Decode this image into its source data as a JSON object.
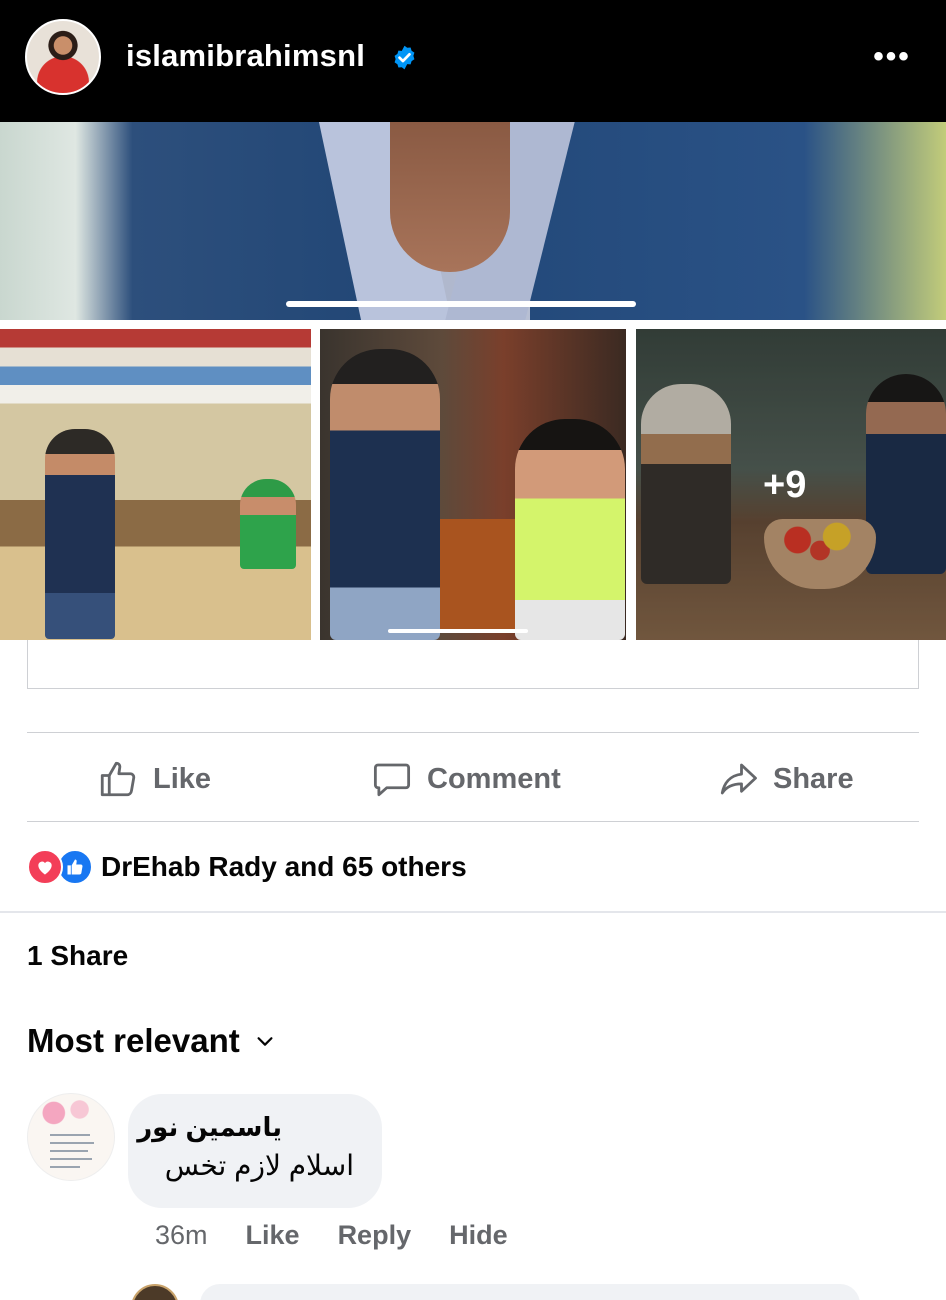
{
  "story_header": {
    "username": "islamibrahimsnl",
    "verified": true,
    "more_icon": "more-horizontal-icon"
  },
  "media": {
    "extra_photos_label": "+9"
  },
  "actions": {
    "like_label": "Like",
    "comment_label": "Comment",
    "share_label": "Share"
  },
  "reactions": {
    "summary": "DrEhab Rady and 65 others",
    "icons": [
      "love-reaction-icon",
      "like-reaction-icon"
    ]
  },
  "shares": {
    "label": "1 Share"
  },
  "comments_sort": {
    "label": "Most relevant"
  },
  "comments": [
    {
      "author": "ياسمين نور",
      "text": "اسلام لازم تخس",
      "time": "36m",
      "like_label": "Like",
      "reply_label": "Reply",
      "hide_label": "Hide"
    }
  ],
  "colors": {
    "accent_blue": "#1877f2",
    "love_red": "#f33e58",
    "secondary_text": "#65676b",
    "bubble_bg": "#f0f2f5"
  }
}
